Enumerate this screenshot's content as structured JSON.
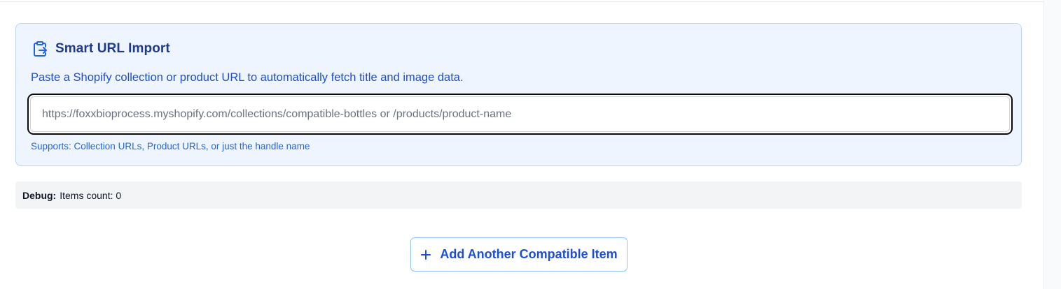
{
  "smart_import": {
    "icon": "clipboard-import-icon",
    "title": "Smart URL Import",
    "description": "Paste a Shopify collection or product URL to automatically fetch title and image data.",
    "input_value": "",
    "input_placeholder": "https://foxxbioprocess.myshopify.com/collections/compatible-bottles or /products/product-name",
    "hint": "Supports: Collection URLs, Product URLs, or just the handle name"
  },
  "debug": {
    "label": "Debug:",
    "text": "Items count: 0"
  },
  "add_button": {
    "icon": "plus-icon",
    "label": "Add Another Compatible Item"
  },
  "colors": {
    "accent": "#1d4ed8",
    "card_background": "#eef5ff",
    "card_border": "#bcd6f6",
    "debug_background": "#f3f4f6"
  }
}
